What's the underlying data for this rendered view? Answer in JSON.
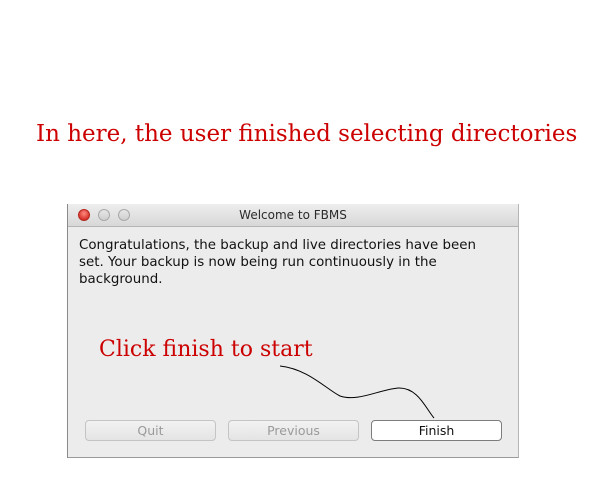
{
  "annotations": {
    "top_caption": "In here, the user finished selecting directories",
    "inner_caption": "Click finish to start"
  },
  "window": {
    "title": "Welcome to FBMS",
    "message": "Congratulations, the backup and live directories have been set. Your backup is now being run continuously in the background.",
    "traffic_lights": {
      "close": "close-icon",
      "minimize": "minimize-icon",
      "zoom": "zoom-icon"
    }
  },
  "buttons": {
    "quit": {
      "label": "Quit",
      "enabled": false
    },
    "previous": {
      "label": "Previous",
      "enabled": false
    },
    "finish": {
      "label": "Finish",
      "enabled": true
    }
  },
  "colors": {
    "annotation": "#cc0000",
    "window_background": "#ececec"
  }
}
